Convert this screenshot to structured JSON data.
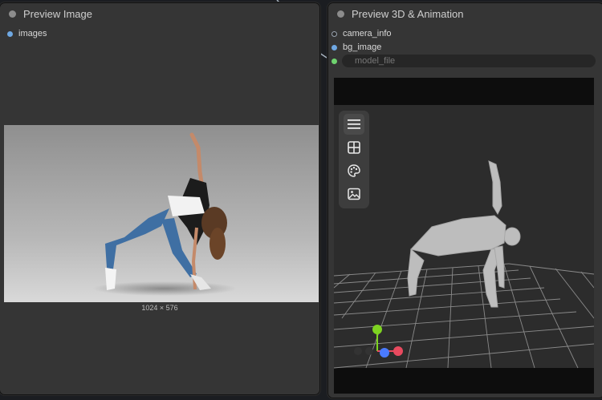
{
  "left_node": {
    "title": "Preview Image",
    "inputs": [
      "images"
    ],
    "image_caption": "1024 × 576"
  },
  "right_node": {
    "title": "Preview 3D & Animation",
    "inputs": [
      "camera_info",
      "bg_image"
    ],
    "model_file_placeholder": "model_file",
    "toolbar": [
      {
        "icon": "menu-icon",
        "active": true
      },
      {
        "icon": "grid-view-icon",
        "active": false
      },
      {
        "icon": "palette-icon",
        "active": false
      },
      {
        "icon": "image-icon",
        "active": false
      }
    ]
  },
  "colors": {
    "node_bg": "#353535",
    "canvas_bg": "#1b1d21",
    "slot_blue": "#6fa8e3",
    "slot_green": "#6fd36f",
    "axis_x": "#e84a5f",
    "axis_y": "#7ed321",
    "axis_z": "#4a7bff"
  }
}
